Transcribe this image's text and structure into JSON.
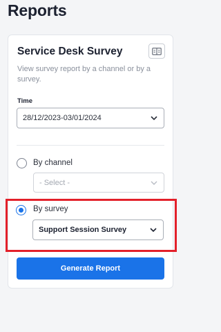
{
  "page": {
    "title": "Reports"
  },
  "card": {
    "title": "Service Desk Survey",
    "description": "View survey report by a channel or by a survey."
  },
  "time": {
    "label": "Time",
    "value": "28/12/2023-03/01/2024"
  },
  "options": {
    "by_channel": {
      "label": "By channel",
      "checked": false,
      "select_placeholder": "- Select -"
    },
    "by_survey": {
      "label": "By survey",
      "checked": true,
      "select_value": "Support Session Survey"
    }
  },
  "actions": {
    "generate_label": "Generate Report"
  },
  "colors": {
    "accent": "#1a73e8",
    "highlight": "#e3202a"
  }
}
